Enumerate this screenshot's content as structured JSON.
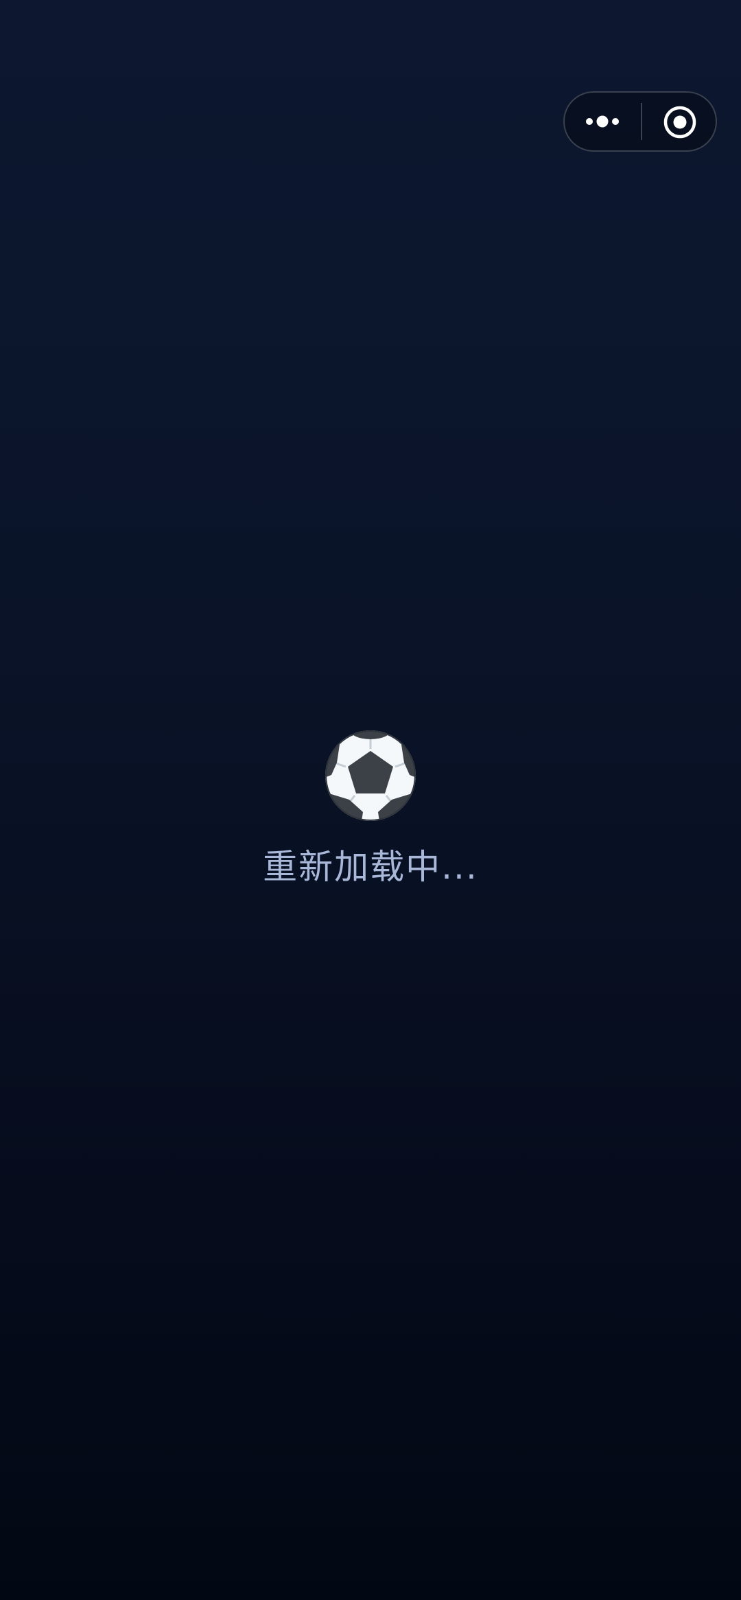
{
  "capsule": {
    "more_icon": "more-dots-icon",
    "close_icon": "circle-target-icon"
  },
  "loader": {
    "icon": "soccer-ball-icon",
    "text": "重新加载中..."
  },
  "colors": {
    "background_top": "#0d1830",
    "background_bottom": "#020813",
    "text": "#a9b8d9",
    "capsule_border": "#3a414e",
    "icon": "#ffffff"
  }
}
